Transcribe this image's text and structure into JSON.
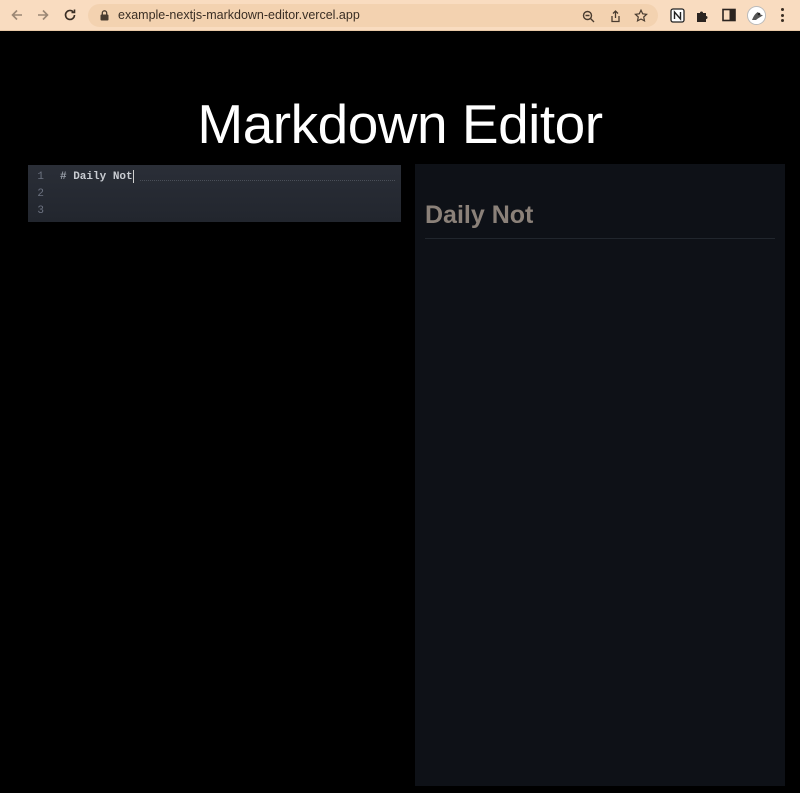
{
  "browser": {
    "url": "example-nextjs-markdown-editor.vercel.app",
    "icons": {
      "back": "back-arrow-icon",
      "forward": "forward-arrow-icon",
      "reload": "reload-icon",
      "lock": "lock-icon",
      "zoom": "zoom-icon",
      "share": "share-icon",
      "bookmark": "star-icon",
      "notion": "notion-extension-icon",
      "extensions": "puzzle-icon",
      "sidepanel": "side-panel-icon",
      "profile": "avatar",
      "menu": "kebab-menu-icon"
    },
    "chrome_color": "#f9dcc0"
  },
  "page": {
    "title": "Markdown Editor"
  },
  "editor": {
    "line_numbers": [
      "1",
      "2",
      "3"
    ],
    "lines": [
      "# Daily Not",
      "",
      ""
    ],
    "hash": "#",
    "line1_text": " Daily Not",
    "background": "#272b34"
  },
  "preview": {
    "heading": "Daily Not",
    "background": "#0e1117"
  }
}
